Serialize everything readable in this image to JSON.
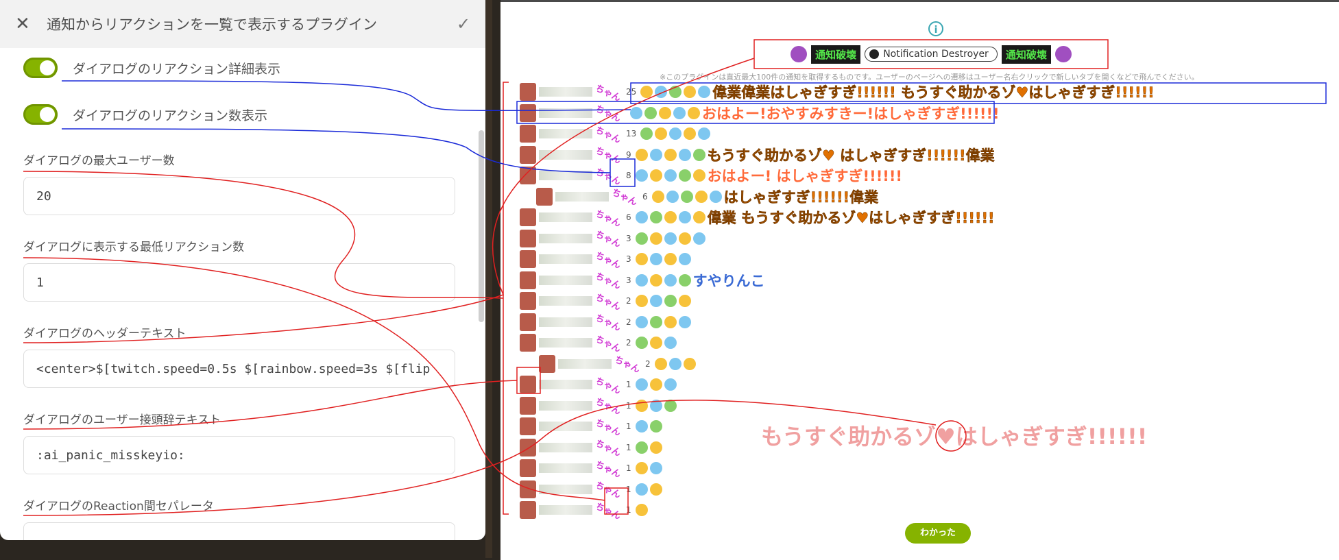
{
  "panel": {
    "title": "通知からリアクションを一覧で表示するプラグイン",
    "toggles": [
      {
        "label": "ダイアログのリアクション詳細表示",
        "on": true
      },
      {
        "label": "ダイアログのリアクション数表示",
        "on": true
      }
    ],
    "fields": [
      {
        "label": "ダイアログの最大ユーザー数",
        "value": "20"
      },
      {
        "label": "ダイアログに表示する最低リアクション数",
        "value": "1"
      },
      {
        "label": "ダイアログのヘッダーテキスト",
        "value": "<center>$[twitch.speed=0.5s $[rainbow.speed=3s $[flip"
      },
      {
        "label": "ダイアログのユーザー接頭辞テキスト",
        "value": ":ai_panic_misskeyio:"
      },
      {
        "label": "ダイアログのReaction間セパレータ",
        "value": ""
      }
    ]
  },
  "dialog": {
    "header": {
      "tag_left": "通知破壊",
      "pill": "Notification Destroyer",
      "tag_right": "通知破壊"
    },
    "note": "※このプラグインは直近最大100件の通知を取得するものです。ユーザーのページへの遷移はユーザー名右クリックで新しいタブを開くなどで飛んでください。",
    "chan": "ちゃん",
    "rows": [
      {
        "count": "25",
        "text": "偉業偉業はしゃぎすぎ!!!!!! もうすぐ助かるゾ♥はしゃぎすぎ!!!!!!"
      },
      {
        "count": "",
        "text": "おはよー!おやすみすきー!はしゃぎすぎ!!!!!!"
      },
      {
        "count": "13",
        "text": ""
      },
      {
        "count": "9",
        "text": "もうすぐ助かるゾ♥ はしゃぎすぎ!!!!!!偉業"
      },
      {
        "count": "8",
        "text": "おはよー! はしゃぎすぎ!!!!!!"
      },
      {
        "count": "6",
        "text": "はしゃぎすぎ!!!!!!偉業"
      },
      {
        "count": "6",
        "text": "偉業 もうすぐ助かるゾ♥はしゃぎすぎ!!!!!!"
      },
      {
        "count": "3",
        "text": ""
      },
      {
        "count": "3",
        "text": ""
      },
      {
        "count": "3",
        "text": "すやりんこ"
      },
      {
        "count": "2",
        "text": ""
      },
      {
        "count": "2",
        "text": ""
      },
      {
        "count": "2",
        "text": ""
      },
      {
        "count": "2",
        "text": ""
      },
      {
        "count": "1",
        "text": ""
      },
      {
        "count": "1",
        "text": ""
      },
      {
        "count": "1",
        "text": ""
      },
      {
        "count": "1",
        "text": ""
      },
      {
        "count": "1",
        "text": ""
      },
      {
        "count": "1",
        "text": ""
      },
      {
        "count": "1",
        "text": ""
      }
    ],
    "big_reaction": "もうすぐ助かるゾ♥はしゃぎすぎ!!!!!!",
    "ok_label": "わかった"
  }
}
